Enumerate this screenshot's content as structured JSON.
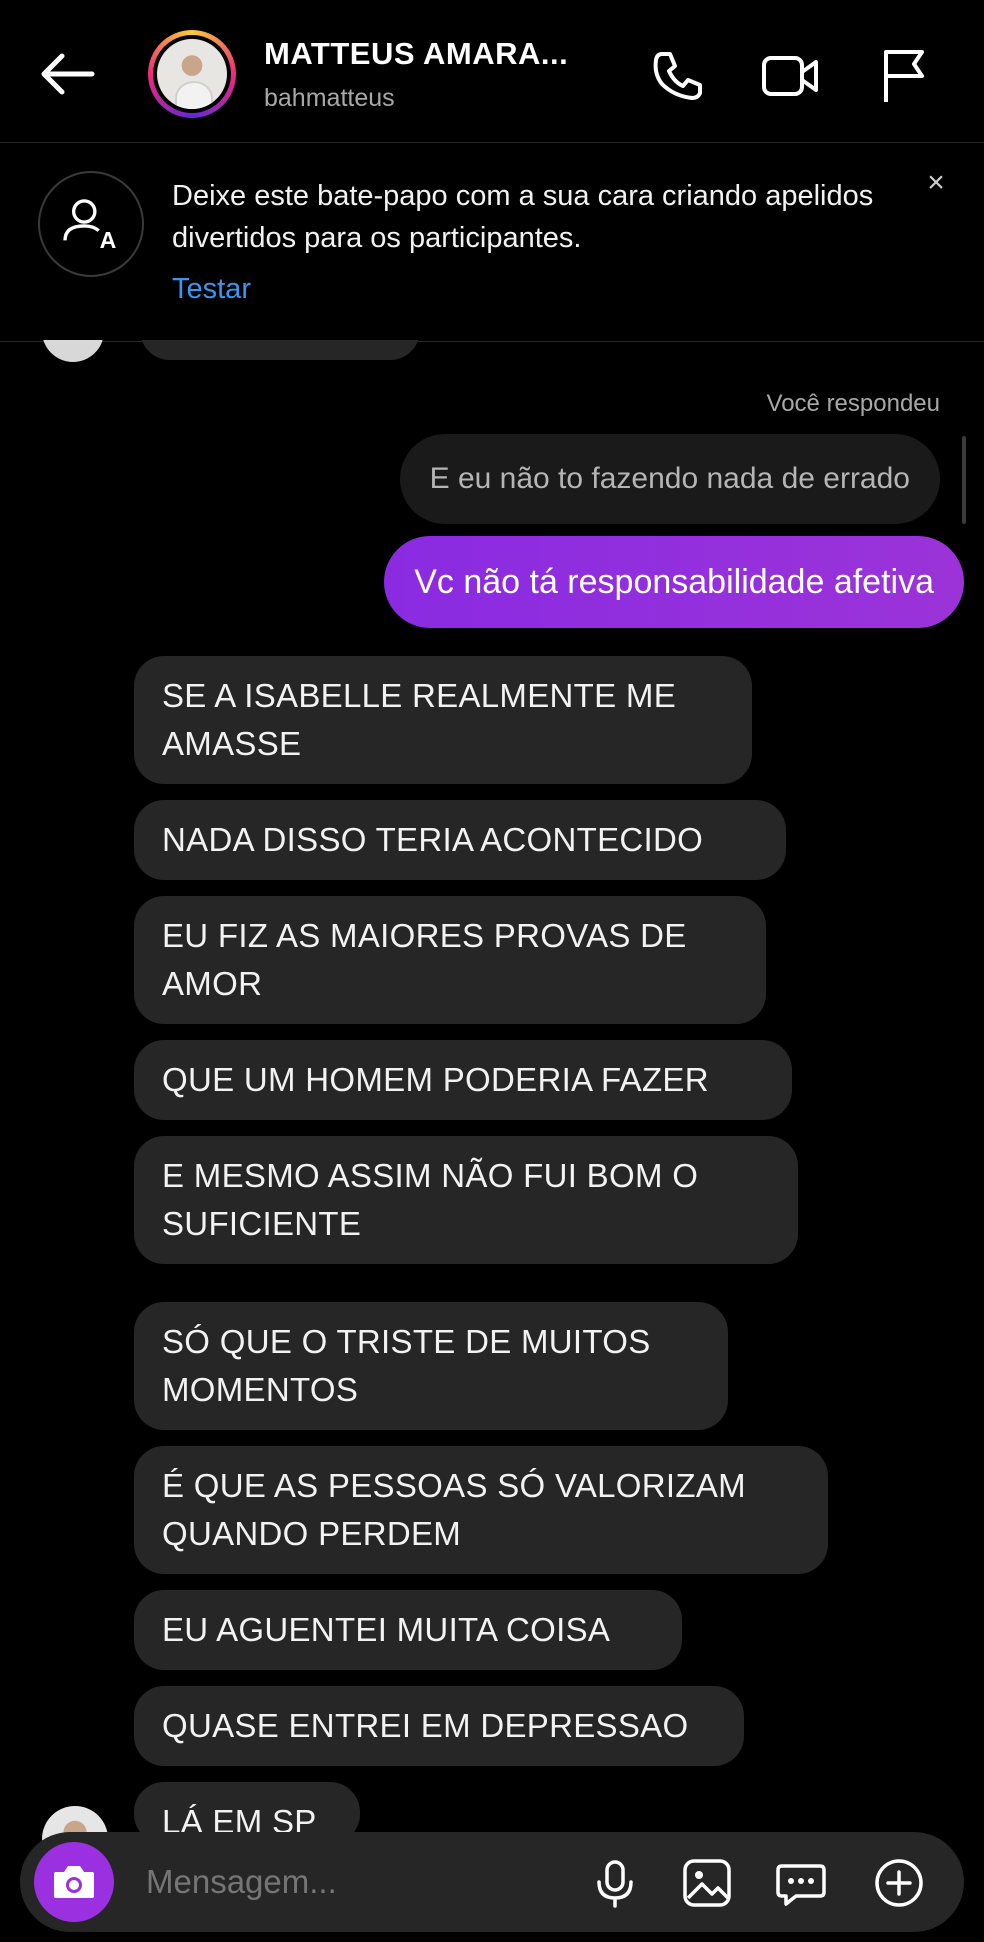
{
  "header": {
    "title": "MATTEUS AMARA...",
    "username": "bahmatteus"
  },
  "banner": {
    "text": "Deixe este bate-papo com a sua cara criando apelidos divertidos para os participantes.",
    "link": "Testar",
    "close": "×"
  },
  "chat": {
    "reply_label": "Você respondeu",
    "reply_text": "E eu não to fazendo nada de errado",
    "sent_text": "Vc não tá responsabilidade afetiva",
    "received": [
      "SE A ISABELLE REALMENTE ME AMASSE",
      "NADA DISSO TERIA ACONTECIDO",
      "EU FIZ AS MAIORES PROVAS DE AMOR",
      "QUE UM HOMEM PODERIA FAZER",
      "E MESMO ASSIM NÃO FUI BOM O SUFICIENTE",
      "SÓ QUE O TRISTE DE MUITOS MOMENTOS",
      "É QUE AS PESSOAS SÓ VALORIZAM QUANDO PERDEM",
      "EU AGUENTEI MUITA COISA",
      "QUASE ENTREI EM DEPRESSAO",
      "LÁ EM SP"
    ]
  },
  "composer": {
    "placeholder": "Mensagem..."
  },
  "colors": {
    "accent_purple": "#9b30e0",
    "sent_bubble": "#8a2be2",
    "received_bubble": "#262626",
    "link_blue": "#3897f0"
  },
  "icons": [
    "back-arrow-icon",
    "phone-icon",
    "video-icon",
    "flag-icon",
    "nickname-icon",
    "close-icon",
    "camera-icon",
    "microphone-icon",
    "gallery-icon",
    "sticker-icon",
    "plus-icon"
  ]
}
